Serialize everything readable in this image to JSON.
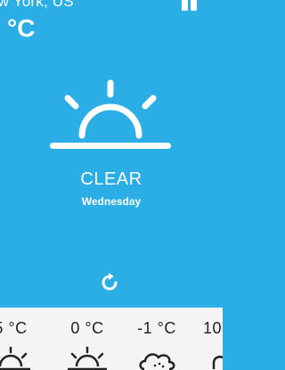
{
  "header": {
    "location": "ew York, US",
    "temperature": "°C"
  },
  "current": {
    "condition": "CLEAR",
    "day": "Wednesday",
    "icon": "sunrise-icon"
  },
  "actions": {
    "refresh_icon": "refresh-icon"
  },
  "forecast": [
    {
      "temp": "5 °C",
      "icon": "sunrise-icon"
    },
    {
      "temp": "0 °C",
      "icon": "sunrise-icon"
    },
    {
      "temp": "-1 °C",
      "icon": "cloud-icon"
    },
    {
      "temp": "10",
      "icon": "partial-icon"
    }
  ],
  "colors": {
    "sky": "#2aaee5",
    "forecast_bg": "#f4f4f4",
    "forecast_text": "#222222"
  }
}
